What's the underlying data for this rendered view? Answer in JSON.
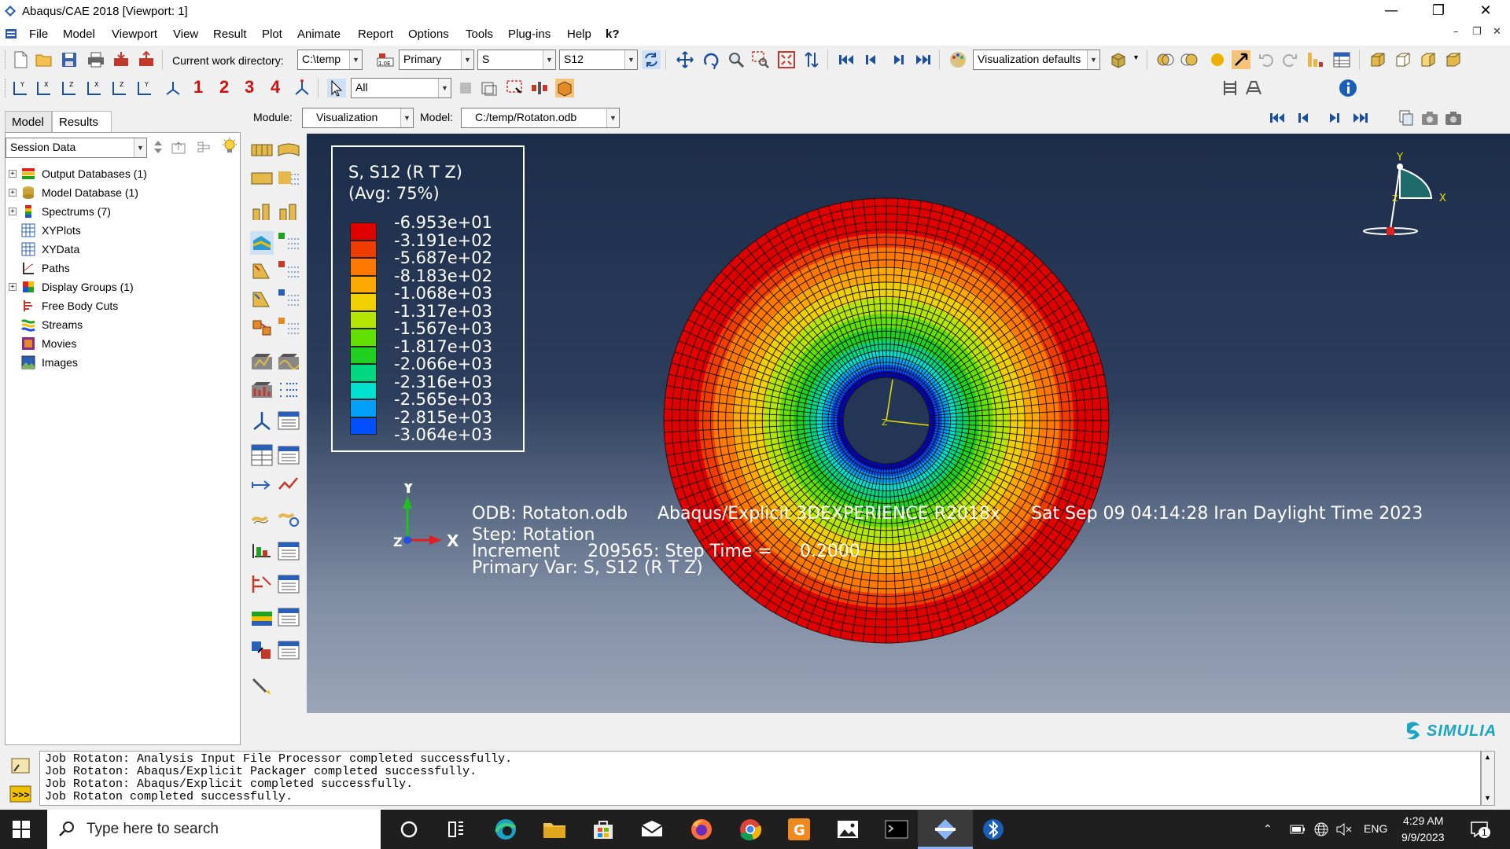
{
  "window": {
    "title": "Abaqus/CAE 2018 [Viewport: 1]"
  },
  "menu": [
    "File",
    "Model",
    "Viewport",
    "View",
    "Result",
    "Plot",
    "Animate",
    "Report",
    "Options",
    "Tools",
    "Plug-ins",
    "Help",
    "k?"
  ],
  "toolbar1": {
    "cwd_label": "Current work directory:",
    "cwd_value": "C:\\temp",
    "field_output_type": "Primary",
    "variable": "S",
    "component": "S12",
    "display_options": "Visualization defaults"
  },
  "toolbar2": {
    "csys_numbers": [
      "1",
      "2",
      "3",
      "4"
    ],
    "selection_filter": "All"
  },
  "context": {
    "module_label": "Module:",
    "module_value": "Visualization",
    "model_label": "Model:",
    "model_value": "C:/temp/Rotaton.odb"
  },
  "tabs": [
    "Model",
    "Results"
  ],
  "session": {
    "dropdown": "Session Data"
  },
  "tree": [
    {
      "label": "Output Databases (1)",
      "expand": true,
      "icon": "output-database-icon"
    },
    {
      "label": "Model Database (1)",
      "expand": true,
      "icon": "model-database-icon"
    },
    {
      "label": "Spectrums (7)",
      "expand": true,
      "icon": "spectrum-icon"
    },
    {
      "label": "XYPlots",
      "expand": false,
      "icon": "xyplot-icon"
    },
    {
      "label": "XYData",
      "expand": false,
      "icon": "xydata-icon"
    },
    {
      "label": "Paths",
      "expand": false,
      "icon": "path-icon"
    },
    {
      "label": "Display Groups (1)",
      "expand": true,
      "icon": "display-group-icon"
    },
    {
      "label": "Free Body Cuts",
      "expand": false,
      "icon": "free-body-cut-icon"
    },
    {
      "label": "Streams",
      "expand": false,
      "icon": "stream-icon"
    },
    {
      "label": "Movies",
      "expand": false,
      "icon": "movie-icon"
    },
    {
      "label": "Images",
      "expand": false,
      "icon": "image-icon"
    }
  ],
  "legend": {
    "title1": "S, S12 (R T Z)",
    "title2": "(Avg: 75%)",
    "values": [
      "-6.953e+01",
      "-3.191e+02",
      "-5.687e+02",
      "-8.183e+02",
      "-1.068e+03",
      "-1.317e+03",
      "-1.567e+03",
      "-1.817e+03",
      "-2.066e+03",
      "-2.316e+03",
      "-2.565e+03",
      "-2.815e+03",
      "-3.064e+03"
    ],
    "colors": [
      "#e00000",
      "#f03c00",
      "#ff7800",
      "#ffa800",
      "#f0d000",
      "#b4e600",
      "#64e000",
      "#20d020",
      "#00d880",
      "#00e0d0",
      "#00a0f8",
      "#0050ff",
      "#0000e0"
    ]
  },
  "viewport": {
    "odb": "ODB: Rotaton.odb",
    "solver": "Abaqus/Explicit 3DEXPERIENCE R2018x",
    "date": "Sat Sep 09 04:14:28 Iran Daylight Time 2023",
    "step": "Step: Rotation",
    "increment": "Increment     209565: Step Time =     0.2000",
    "primary_var": "Primary Var: S, S12 (R T Z)",
    "axis_y": "Y",
    "axis_x": "X",
    "axis_z": "Z",
    "triad_y": "Y",
    "triad_x": "X",
    "triad_z": "Z",
    "brand": "SIMULIA"
  },
  "messages": [
    "Job Rotaton: Analysis Input File Processor completed successfully.",
    "Job Rotaton: Abaqus/Explicit Packager completed successfully.",
    "Job Rotaton: Abaqus/Explicit completed successfully.",
    "Job Rotaton completed successfully."
  ],
  "taskbar": {
    "search_placeholder": "Type here to search",
    "lang": "ENG",
    "time": "4:29 AM",
    "date": "9/9/2023",
    "notifications": "1"
  }
}
